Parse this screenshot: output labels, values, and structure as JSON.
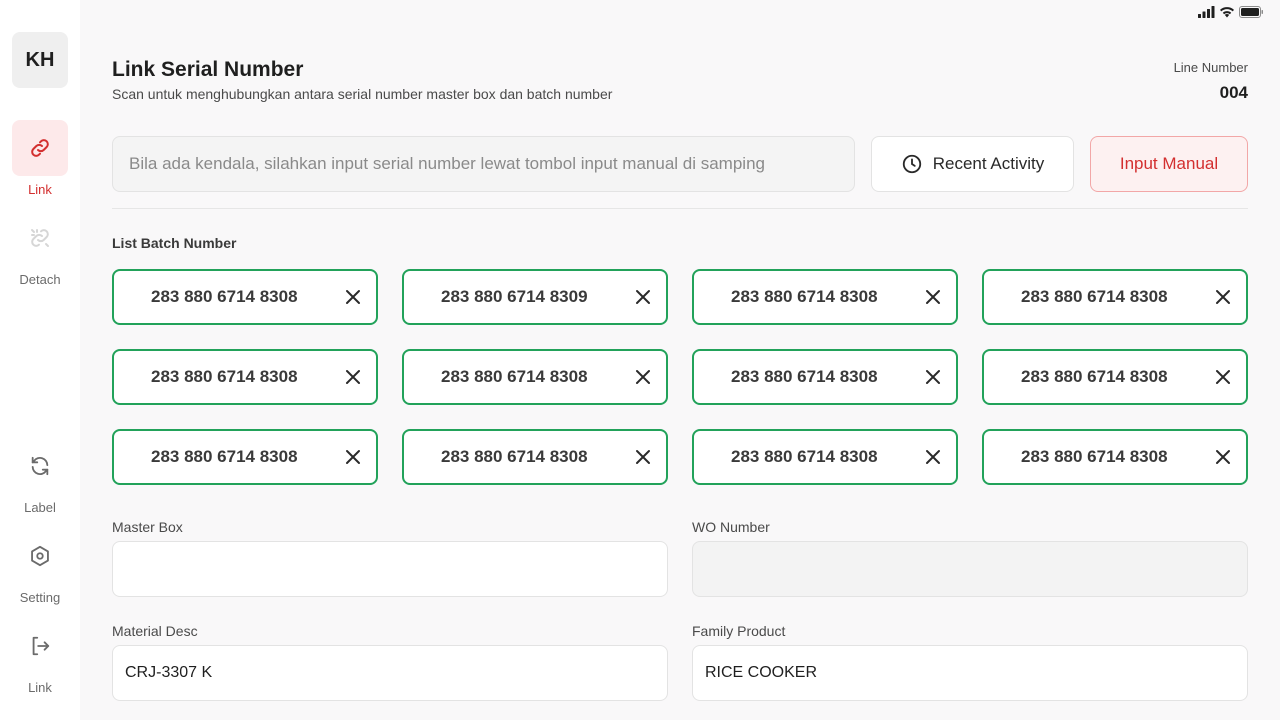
{
  "sidebar": {
    "avatar_initials": "KH",
    "items": [
      {
        "label": "Link",
        "icon": "link-icon",
        "active": true
      },
      {
        "label": "Detach",
        "icon": "unlink-icon",
        "active": false
      },
      {
        "label": "Label",
        "icon": "refresh-icon",
        "active": false
      },
      {
        "label": "Setting",
        "icon": "gear-icon",
        "active": false
      },
      {
        "label": "Link",
        "icon": "logout-icon",
        "active": false
      }
    ]
  },
  "header": {
    "title": "Link Serial Number",
    "subtitle": "Scan untuk menghubungkan antara serial number master box dan batch number",
    "line_number_label": "Line Number",
    "line_number_value": "004"
  },
  "scan": {
    "placeholder": "Bila ada kendala, silahkan input serial number lewat tombol input manual di samping",
    "recent_activity_label": "Recent Activity",
    "input_manual_label": "Input Manual"
  },
  "batch_list": {
    "title": "List Batch Number",
    "items": [
      "283 880 6714 8308",
      "283 880 6714 8309",
      "283 880 6714 8308",
      "283 880 6714 8308",
      "283 880 6714 8308",
      "283 880 6714 8308",
      "283 880 6714 8308",
      "283 880 6714 8308",
      "283 880 6714 8308",
      "283 880 6714 8308",
      "283 880 6714 8308",
      "283 880 6714 8308"
    ]
  },
  "form": {
    "master_box": {
      "label": "Master Box",
      "value": ""
    },
    "wo_number": {
      "label": "WO Number",
      "value": ""
    },
    "material_desc": {
      "label": "Material Desc",
      "value": "CRJ-3307 K"
    },
    "family_product": {
      "label": "Family Product",
      "value": "RICE COOKER"
    }
  },
  "colors": {
    "accent_red": "#d32f2f",
    "chip_green": "#22a25a",
    "active_bg": "#fde9ea"
  }
}
